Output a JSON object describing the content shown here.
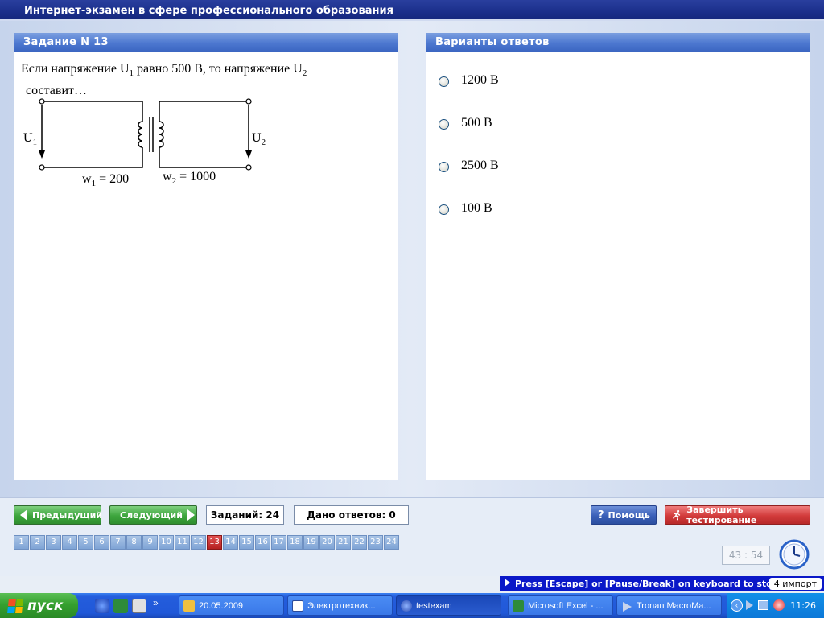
{
  "window": {
    "title": "Интернет-экзамен в сфере профессионального образования"
  },
  "task_panel": {
    "title": "Задание N 13",
    "question_line1_a": "Если напряжение  U",
    "question_line1_sub1": "1",
    "question_line1_b": "  равно 500 В, то напряжение  U",
    "question_line1_sub2": "2",
    "question_line2": "составит…",
    "diagram": {
      "u1_label": "U",
      "u1_sub": "1",
      "u2_label": "U",
      "u2_sub": "2",
      "w1_label": "w",
      "w1_sub": "1",
      "w1_value": " = 200",
      "w2_label": "w",
      "w2_sub": "2",
      "w2_value": " = 1000"
    }
  },
  "answers_panel": {
    "title": "Варианты ответов",
    "options": [
      {
        "label": "1200 В"
      },
      {
        "label": "500 В"
      },
      {
        "label": "2500 В"
      },
      {
        "label": "100 В"
      }
    ]
  },
  "controls": {
    "prev_label": "Предыдущий",
    "next_label": "Следующий",
    "tasks_count": "Заданий: 24",
    "answers_given": "Дано ответов: 0",
    "help_label": "Помощь",
    "finish_label": "Завершить тестирование"
  },
  "pages": [
    "1",
    "2",
    "3",
    "4",
    "5",
    "6",
    "7",
    "8",
    "9",
    "10",
    "11",
    "12",
    "13",
    "14",
    "15",
    "16",
    "17",
    "18",
    "19",
    "20",
    "21",
    "22",
    "23",
    "24"
  ],
  "current_page": "13",
  "timer": "43 : 54",
  "hint": {
    "text": "Press [Escape] or [Pause/Break] on keyboard to stop",
    "badge": "4 импорт"
  },
  "taskbar": {
    "start_label": "пуск",
    "tasks": [
      {
        "label": "20.05.2009",
        "icon": "folder-icon"
      },
      {
        "label": "Электротехник...",
        "icon": "word-icon"
      },
      {
        "label": "testexam",
        "icon": "testexam-icon"
      },
      {
        "label": "Microsoft Excel - ...",
        "icon": "excel-icon"
      },
      {
        "label": "Tronan MacroMa...",
        "icon": "play-icon"
      }
    ],
    "clock": "11:26"
  }
}
